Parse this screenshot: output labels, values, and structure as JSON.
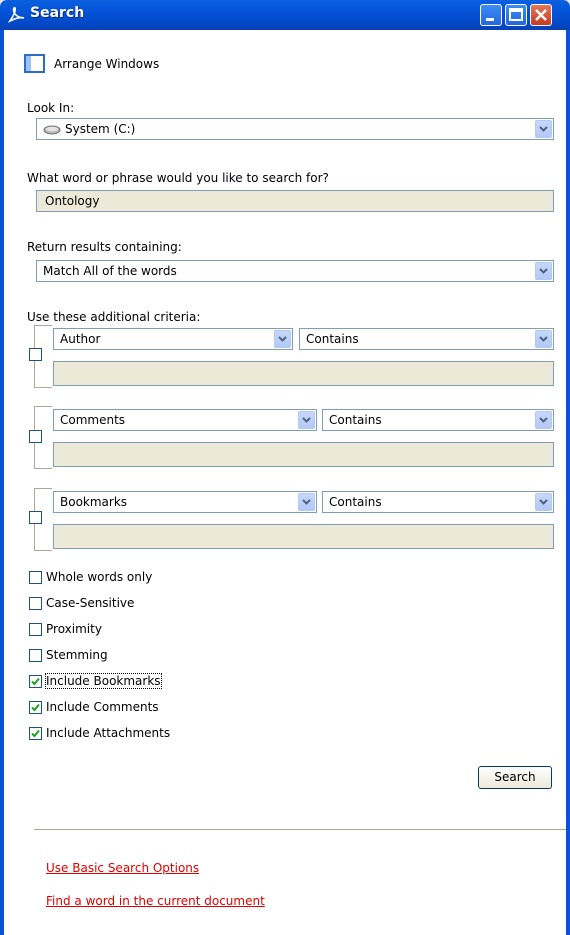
{
  "window": {
    "title": "Search",
    "icon": "acrobat-icon",
    "controls": [
      "minimize-icon",
      "maximize-icon",
      "close-icon"
    ]
  },
  "arrange_windows": {
    "label": "Arrange Windows",
    "icon": "arrange-windows-icon"
  },
  "look_in": {
    "label": "Look In:",
    "value": "System (C:)",
    "icon": "drive-icon"
  },
  "search_phrase": {
    "label": "What word or phrase would you like to search for?",
    "value": "Ontology"
  },
  "return_results": {
    "label": "Return results containing:",
    "value": "Match All of the words"
  },
  "criteria": {
    "label": "Use these additional criteria:",
    "rows": [
      {
        "field": "Author",
        "operator": "Contains",
        "checked": false,
        "value": ""
      },
      {
        "field": "Comments",
        "operator": "Contains",
        "checked": false,
        "value": ""
      },
      {
        "field": "Bookmarks",
        "operator": "Contains",
        "checked": false,
        "value": ""
      }
    ]
  },
  "options": [
    {
      "label": "Whole words only",
      "checked": false
    },
    {
      "label": "Case-Sensitive",
      "checked": false
    },
    {
      "label": "Proximity",
      "checked": false
    },
    {
      "label": "Stemming",
      "checked": false
    },
    {
      "label": "Include Bookmarks",
      "checked": true
    },
    {
      "label": "Include Comments",
      "checked": true
    },
    {
      "label": "Include Attachments",
      "checked": true
    }
  ],
  "search_button": {
    "label": "Search"
  },
  "links": {
    "basic_search": "Use Basic Search Options",
    "find_word": "Find a word in the current document"
  },
  "colors": {
    "title_bar": "#0553d8",
    "link": "#e00000",
    "check": "#21a121"
  }
}
